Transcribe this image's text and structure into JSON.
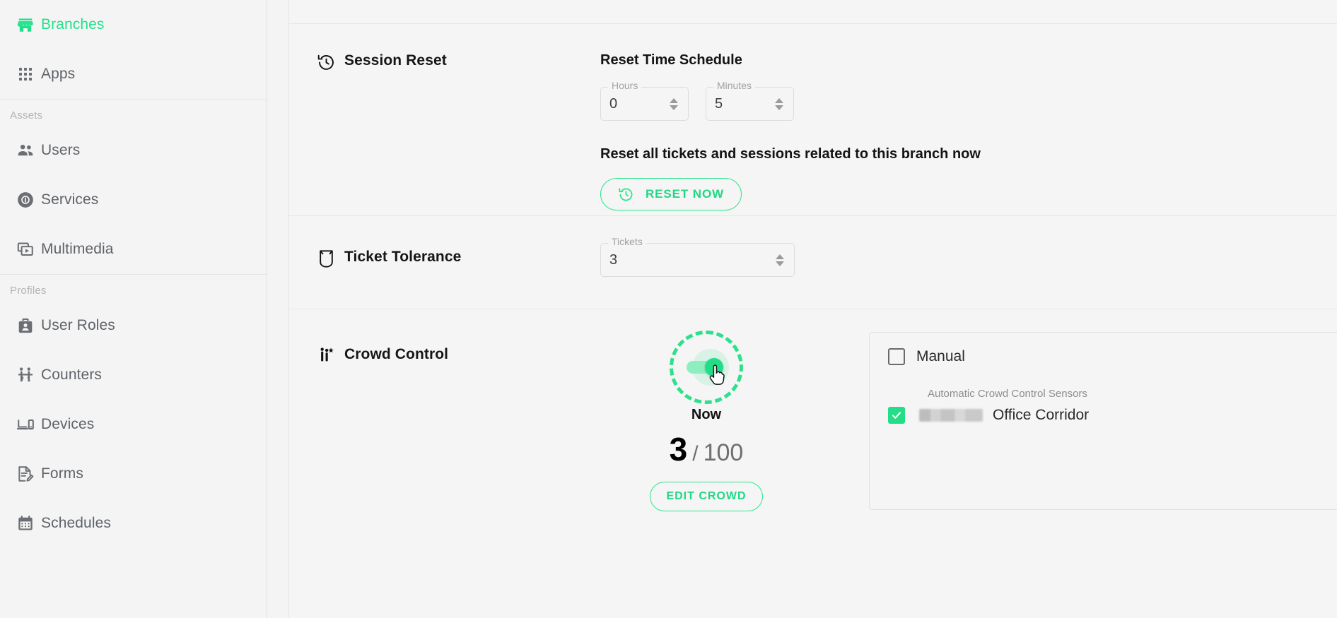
{
  "sidebar": {
    "groups": [
      {
        "label": "",
        "items": [
          {
            "label": "Branches",
            "icon": "store-icon",
            "active": true
          },
          {
            "label": "Apps",
            "icon": "apps-grid-icon",
            "active": false
          }
        ]
      },
      {
        "label": "Assets",
        "items": [
          {
            "label": "Users",
            "icon": "users-icon",
            "active": false
          },
          {
            "label": "Services",
            "icon": "services-badge-icon",
            "active": false
          },
          {
            "label": "Multimedia",
            "icon": "multimedia-icon",
            "active": false
          }
        ]
      },
      {
        "label": "Profiles",
        "items": [
          {
            "label": "User Roles",
            "icon": "user-roles-briefcase-icon",
            "active": false
          },
          {
            "label": "Counters",
            "icon": "counters-icon",
            "active": false
          },
          {
            "label": "Devices",
            "icon": "devices-icon",
            "active": false
          },
          {
            "label": "Forms",
            "icon": "forms-icon",
            "active": false
          },
          {
            "label": "Schedules",
            "icon": "calendar-icon",
            "active": false
          }
        ]
      }
    ]
  },
  "main": {
    "clipped_top_text": "",
    "session_reset": {
      "title": "Session Reset",
      "icon": "history-clock-icon",
      "schedule_heading": "Reset Time Schedule",
      "hours": {
        "legend": "Hours",
        "value": "0"
      },
      "minutes": {
        "legend": "Minutes",
        "value": "5"
      },
      "reset_note": "Reset all tickets and sessions related to this branch now",
      "reset_button": "RESET NOW",
      "reset_button_icon": "history-clock-icon"
    },
    "ticket_tolerance": {
      "title": "Ticket Tolerance",
      "icon": "ticket-shield-icon",
      "tickets": {
        "legend": "Tickets",
        "value": "3"
      }
    },
    "crowd_control": {
      "title": "Crowd Control",
      "icon": "crowd-people-icon",
      "toggle_on": true,
      "toggle_highlighted": true,
      "now_label": "Now",
      "current": "3",
      "separator": "/",
      "capacity": "100",
      "edit_button": "EDIT CROWD",
      "manual": {
        "label": "Manual",
        "checked": false
      },
      "sensors_title": "Automatic Crowd Control Sensors",
      "sensors": [
        {
          "name": "Office Corridor",
          "checked": true,
          "redacted_prefix": true
        }
      ]
    }
  },
  "colors": {
    "accent_green": "#2ee68e",
    "accent_green_dark": "#1fd884",
    "toggle_knob": "#21dd88",
    "page_bg": "#f4f4f4",
    "text_primary": "#161616",
    "text_muted": "#8d8d8d",
    "border": "#e6e6e6"
  }
}
